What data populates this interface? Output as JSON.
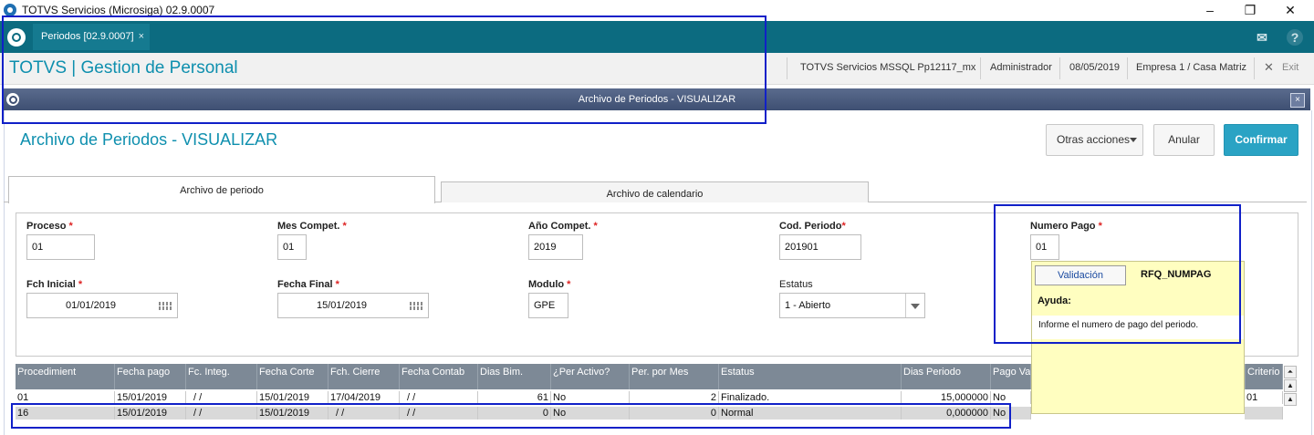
{
  "window": {
    "title": "TOTVS Servicios (Microsiga) 02.9.0007",
    "minimize": "–",
    "maximize": "❐",
    "close": "✕"
  },
  "tabs": [
    {
      "label": "Periodos [02.9.0007]",
      "close": "×"
    }
  ],
  "header": {
    "module_title": "TOTVS | Gestion de Personal",
    "server": "TOTVS Servicios MSSQL Pp12117_mx",
    "user": "Administrador",
    "date": "08/05/2019",
    "company": "Empresa 1 / Casa Matriz",
    "exit_label": "Exit",
    "exit_icon": "✕",
    "mail_icon": "✉",
    "help_icon": "?"
  },
  "dialog": {
    "header_title": "Archivo de Periodos - VISUALIZAR",
    "close_icon": "×",
    "subtitle": "Archivo de Periodos - VISUALIZAR",
    "buttons": {
      "other_actions": "Otras acciones",
      "cancel": "Anular",
      "confirm": "Confirmar"
    },
    "form_tabs": [
      "Archivo de periodo",
      "Archivo de calendario"
    ]
  },
  "form": {
    "required_mark": "*",
    "proceso": {
      "label": "Proceso",
      "value": "01"
    },
    "mes_compet": {
      "label": "Mes Compet.",
      "value": "01"
    },
    "anio_compet": {
      "label": "Año Compet.",
      "value": "2019"
    },
    "cod_periodo": {
      "label": "Cod. Periodo",
      "value": "201901"
    },
    "numero_pago": {
      "label": "Numero Pago",
      "value": "01"
    },
    "fch_inicial": {
      "label": "Fch Inicial",
      "value": "01/01/2019"
    },
    "fecha_final": {
      "label": "Fecha Final",
      "value": "15/01/2019"
    },
    "modulo": {
      "label": "Modulo",
      "value": "GPE"
    },
    "estatus": {
      "label": "Estatus",
      "value": "1 - Abierto"
    }
  },
  "help_popup": {
    "validation_button": "Validación",
    "field_code": "RFQ_NUMPAG",
    "ayuda_label": "Ayuda:",
    "text": "Informe el numero de pago del periodo.",
    "background_color": "#fffec0"
  },
  "grid": {
    "columns": [
      "Procedimient",
      "Fecha pago",
      "Fc. Integ.",
      "Fecha Corte",
      "Fch. Cierre",
      "Fecha Contab",
      "Dias Bim.",
      "¿Per Activo?",
      "Per. por Mes",
      "Estatus",
      "Dias Periodo",
      "Pago Va",
      "Criterio"
    ],
    "rows": [
      [
        "01",
        "15/01/2019",
        " /  /",
        "15/01/2019",
        "17/04/2019",
        " /  /",
        "61",
        "No",
        "2",
        "Finalizado.",
        "15,000000",
        "No",
        "01"
      ],
      [
        "16",
        "15/01/2019",
        " /  /",
        "15/01/2019",
        " /  /",
        " /  /",
        "0",
        "No",
        "0",
        "Normal",
        "0,000000",
        "No",
        ""
      ]
    ],
    "scroll_icons": [
      "⏶",
      "▲",
      "▲"
    ]
  },
  "colors": {
    "tabstrip": "#0c6b80",
    "accent": "#0e8fae",
    "confirm_button": "#2aa3c4",
    "grid_header": "#7d8996",
    "highlight": "#1020c8"
  }
}
